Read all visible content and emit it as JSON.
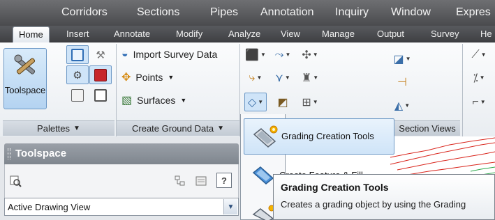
{
  "menubar": {
    "items": [
      "Corridors",
      "Sections",
      "Pipes",
      "Annotation",
      "Inquiry",
      "Window",
      "Expres"
    ]
  },
  "ribbon_tabs": [
    {
      "label": "Home",
      "active": true
    },
    {
      "label": "Insert",
      "active": false
    },
    {
      "label": "Annotate",
      "active": false
    },
    {
      "label": "Modify",
      "active": false
    },
    {
      "label": "Analyze",
      "active": false
    },
    {
      "label": "View",
      "active": false
    },
    {
      "label": "Manage",
      "active": false
    },
    {
      "label": "Output",
      "active": false
    },
    {
      "label": "Survey",
      "active": false
    },
    {
      "label": "He",
      "active": false
    }
  ],
  "palettes": {
    "toolspace_label": "Toolspace",
    "panel_label": "Palettes"
  },
  "create_ground_data": {
    "import_survey_label": "Import Survey Data",
    "points_label": "Points",
    "surfaces_label": "Surfaces",
    "panel_label": "Create Ground Data"
  },
  "section_views": {
    "panel_label": "Section Views"
  },
  "dropdown": {
    "grading_item_label": "Grading Creation Tools",
    "partial_item_label": "Create Feature & Fill"
  },
  "tooltip": {
    "title": "Grading Creation Tools",
    "description": "Creates a grading object by using the Grading"
  },
  "toolspace": {
    "title": "Toolspace",
    "help_label": "?",
    "combo_value": "Active Drawing View"
  },
  "colors": {
    "menubar": "#5c5d60",
    "accent_blue": "#6c98c6",
    "hover_fill": "#cfe4f8",
    "contour_red": "#d9251c",
    "contour_green": "#2aa84a"
  }
}
